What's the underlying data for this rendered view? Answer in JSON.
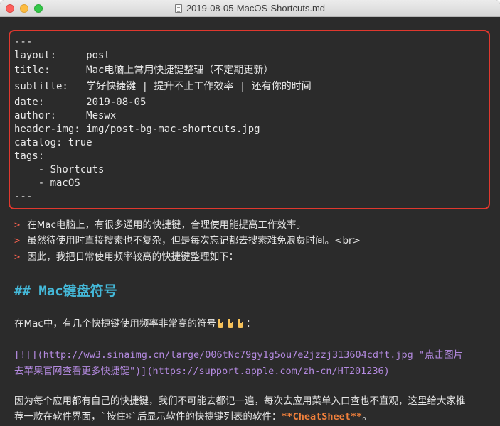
{
  "window": {
    "title": "2019-08-05-MacOS-Shortcuts.md"
  },
  "frontmatter": {
    "lines": [
      "---",
      "layout:     post",
      "title:      Mac电脑上常用快捷键整理（不定期更新）",
      "subtitle:   学好快捷键 | 提升不止工作效率 | 还有你的时间",
      "date:       2019-08-05",
      "author:     Meswx",
      "header-img: img/post-bg-mac-shortcuts.jpg",
      "catalog: true",
      "tags:",
      "    - Shortcuts",
      "    - macOS",
      "---"
    ]
  },
  "quotes": {
    "marker": ">",
    "lines": [
      "在Mac电脑上，有很多通用的快捷键，合理使用能提高工作效率。",
      "虽然待使用时直接搜索也不复杂，但是每次忘记都去搜索难免浪费时间。<br>",
      "因此，我把日常使用频率较高的快捷键整理如下："
    ]
  },
  "heading": {
    "text": "## Mac键盘符号"
  },
  "para1": {
    "text": "在Mac中，有几个快捷键使用频率非常高的符号",
    "emoji_count": 3,
    "suffix": "："
  },
  "link": {
    "line1_prefix": "[![](",
    "line1_url": "http://ww3.sinaimg.cn/large/006tNc79gy1g5ou7e2jzzj313604cdft.jpg",
    "line1_title": " \"点击图片",
    "line2_title": "去苹果官网查看更多快捷键\"",
    "line2_mid": ")](",
    "line2_url": "https://support.apple.com/zh-cn/HT201236",
    "line2_end": ")"
  },
  "para2": {
    "line1": "因为每个应用都有自己的快捷键，我们不可能去都记一遍，每次去应用菜单入口查也不直观，这里给大家推",
    "line2_prefix": "荐一款在软件界面，",
    "line2_code": "`按住⌘`",
    "line2_mid": "后显示软件的快捷键列表的软件：",
    "line2_bold": "**CheatSheet**",
    "line2_end": "。"
  },
  "colors": {
    "background": "#2b2b2b",
    "highlight_border": "#e0382e",
    "quote_marker": "#f0604e",
    "heading": "#44b8d8",
    "link": "#b48ae0",
    "bold": "#f0803c"
  }
}
